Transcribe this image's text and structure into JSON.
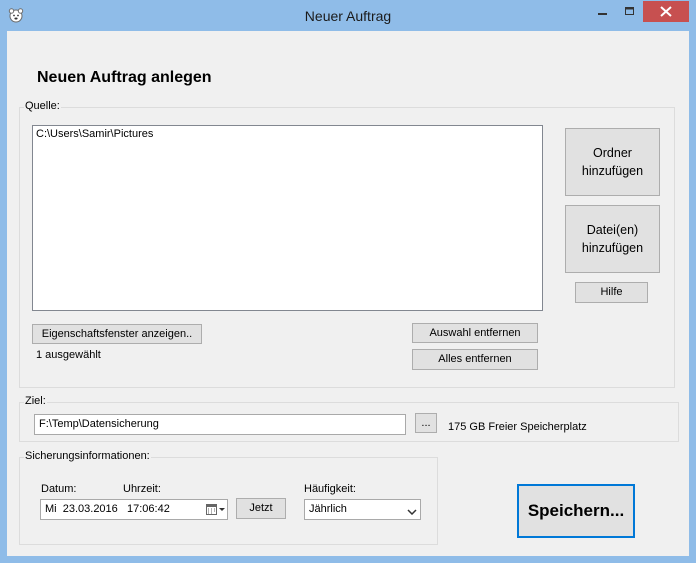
{
  "window": {
    "title": "Neuer Auftrag",
    "app_icon": "app-icon",
    "close_color": "#c75050",
    "frame_color": "#8fbce8"
  },
  "heading": "Neuen Auftrag anlegen",
  "source": {
    "group_label": "Quelle:",
    "items": [
      "C:\\Users\\Samir\\Pictures"
    ],
    "add_folder_label_1": "Ordner",
    "add_folder_label_2": "hinzufügen",
    "add_files_label_1": "Datei(en)",
    "add_files_label_2": "hinzufügen",
    "help_label": "Hilfe",
    "properties_label": "Eigenschaftsfenster anzeigen..",
    "selection_status": "1 ausgewählt",
    "remove_selection_label": "Auswahl entfernen",
    "remove_all_label": "Alles entfernen"
  },
  "target": {
    "group_label": "Ziel:",
    "path": "F:\\Temp\\Datensicherung",
    "browse_label": "...",
    "free_space": "175 GB Freier Speicherplatz"
  },
  "backup_info": {
    "group_label": "Sicherungsinformationen:",
    "date_label": "Datum:",
    "time_label": "Uhrzeit:",
    "weekday": "Mi",
    "date": "23.03.2016",
    "time": "17:06:42",
    "now_label": "Jetzt",
    "frequency_label": "Häufigkeit:",
    "frequency_value": "Jährlich"
  },
  "save_label": "Speichern..."
}
